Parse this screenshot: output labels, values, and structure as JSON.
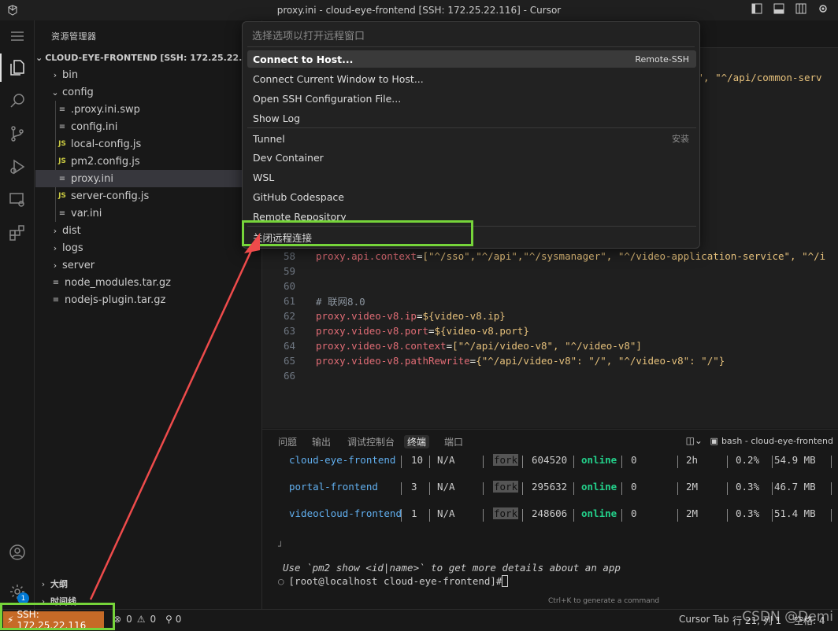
{
  "window": {
    "title": "proxy.ini - cloud-eye-frontend [SSH: 172.25.22.116] - Cursor"
  },
  "sidebar": {
    "title": "资源管理器",
    "root": "CLOUD-EYE-FRONTEND [SSH: 172.25.22.116]",
    "items": [
      {
        "label": "bin",
        "type": "folder",
        "expanded": false
      },
      {
        "label": "config",
        "type": "folder",
        "expanded": true
      },
      {
        "label": ".proxy.ini.swp",
        "type": "file"
      },
      {
        "label": "config.ini",
        "type": "file"
      },
      {
        "label": "local-config.js",
        "type": "js"
      },
      {
        "label": "pm2.config.js",
        "type": "js"
      },
      {
        "label": "proxy.ini",
        "type": "file",
        "selected": true
      },
      {
        "label": "server-config.js",
        "type": "js"
      },
      {
        "label": "var.ini",
        "type": "file"
      },
      {
        "label": "dist",
        "type": "folder",
        "expanded": false
      },
      {
        "label": "logs",
        "type": "folder",
        "expanded": false
      },
      {
        "label": "server",
        "type": "folder",
        "expanded": false
      },
      {
        "label": "node_modules.tar.gz",
        "type": "file"
      },
      {
        "label": "nodejs-plugin.tar.gz",
        "type": "file"
      }
    ],
    "outline": "大纲",
    "timeline": "时间线"
  },
  "activity": {
    "accounts_badge": "1"
  },
  "command_palette": {
    "placeholder": "选择选项以打开远程窗口",
    "items": [
      {
        "label": "Connect to Host...",
        "shortcut": "Remote-SSH",
        "highlighted": true
      },
      {
        "label": "Connect Current Window to Host...",
        "shortcut": ""
      },
      {
        "label": "Open SSH Configuration File...",
        "shortcut": ""
      },
      {
        "label": "Show Log",
        "shortcut": ""
      },
      {
        "label": "Tunnel",
        "shortcut": "安装"
      },
      {
        "label": "Dev Container",
        "shortcut": ""
      },
      {
        "label": "WSL",
        "shortcut": ""
      },
      {
        "label": "GitHub Codespace",
        "shortcut": ""
      },
      {
        "label": "Remote Repository",
        "shortcut": ""
      },
      {
        "label": "关闭远程连接",
        "shortcut": ""
      }
    ]
  },
  "editor": {
    "visible_line1_tail": "p\", \"^/api/common-serv",
    "lines": [
      {
        "num": "58",
        "key": "proxy.api.context",
        "value": "[\"^/sso\",\"^/api\",\"^/sysmanager\", \"^/video-application-service\", \"^/i"
      },
      {
        "num": "59",
        "key": "",
        "value": ""
      },
      {
        "num": "60",
        "key": "",
        "value": ""
      },
      {
        "num": "61",
        "comment": "# 联网8.0"
      },
      {
        "num": "62",
        "key": "proxy.video-v8.ip",
        "value": "${video-v8.ip}"
      },
      {
        "num": "63",
        "key": "proxy.video-v8.port",
        "value": "${video-v8.port}"
      },
      {
        "num": "64",
        "key": "proxy.video-v8.context",
        "value": "[\"^/api/video-v8\", \"^/video-v8\"]"
      },
      {
        "num": "65",
        "key": "proxy.video-v8.pathRewrite",
        "value": "{\"^/api/video-v8\": \"/\", \"^/video-v8\": \"/\"}"
      },
      {
        "num": "66",
        "key": "",
        "value": ""
      }
    ]
  },
  "panel": {
    "tabs": [
      "问题",
      "输出",
      "调试控制台",
      "终端",
      "端口"
    ],
    "active_tab": "终端",
    "terminal_name": "bash - cloud-eye-frontend",
    "processes": [
      {
        "name": "cloud-eye-frontend",
        "id": "10",
        "version": "N/A",
        "mode": "fork",
        "pid": "604520",
        "status": "online",
        "restarts": "0",
        "uptime": "2h",
        "cpu": "0.2%",
        "mem": "54.9 MB"
      },
      {
        "name": "portal-frontend",
        "id": "3",
        "version": "N/A",
        "mode": "fork",
        "pid": "295632",
        "status": "online",
        "restarts": "0",
        "uptime": "2M",
        "cpu": "0.3%",
        "mem": "46.7 MB"
      },
      {
        "name": "videocloud-frontend",
        "id": "1",
        "version": "N/A",
        "mode": "fork",
        "pid": "248606",
        "status": "online",
        "restarts": "0",
        "uptime": "2M",
        "cpu": "0.3%",
        "mem": "51.4 MB"
      }
    ],
    "hint": "Use `pm2 show <id|name>` to get more details about an app",
    "prompt": "[root@localhost cloud-eye-frontend]# ",
    "generate_hint": "Ctrl+K to generate a command"
  },
  "statusbar": {
    "remote": "SSH: 172.25.22.116",
    "errors": "0",
    "warnings": "0",
    "ports": "0",
    "cursor_tab": "Cursor Tab",
    "position": "行 21, 列 1",
    "spaces": "空格: 4",
    "watermark": "CSDN @Demi"
  },
  "colors": {
    "accent_box": "#76d43a",
    "arrow": "#ee4b4b",
    "remote_bg": "#c66a27"
  }
}
